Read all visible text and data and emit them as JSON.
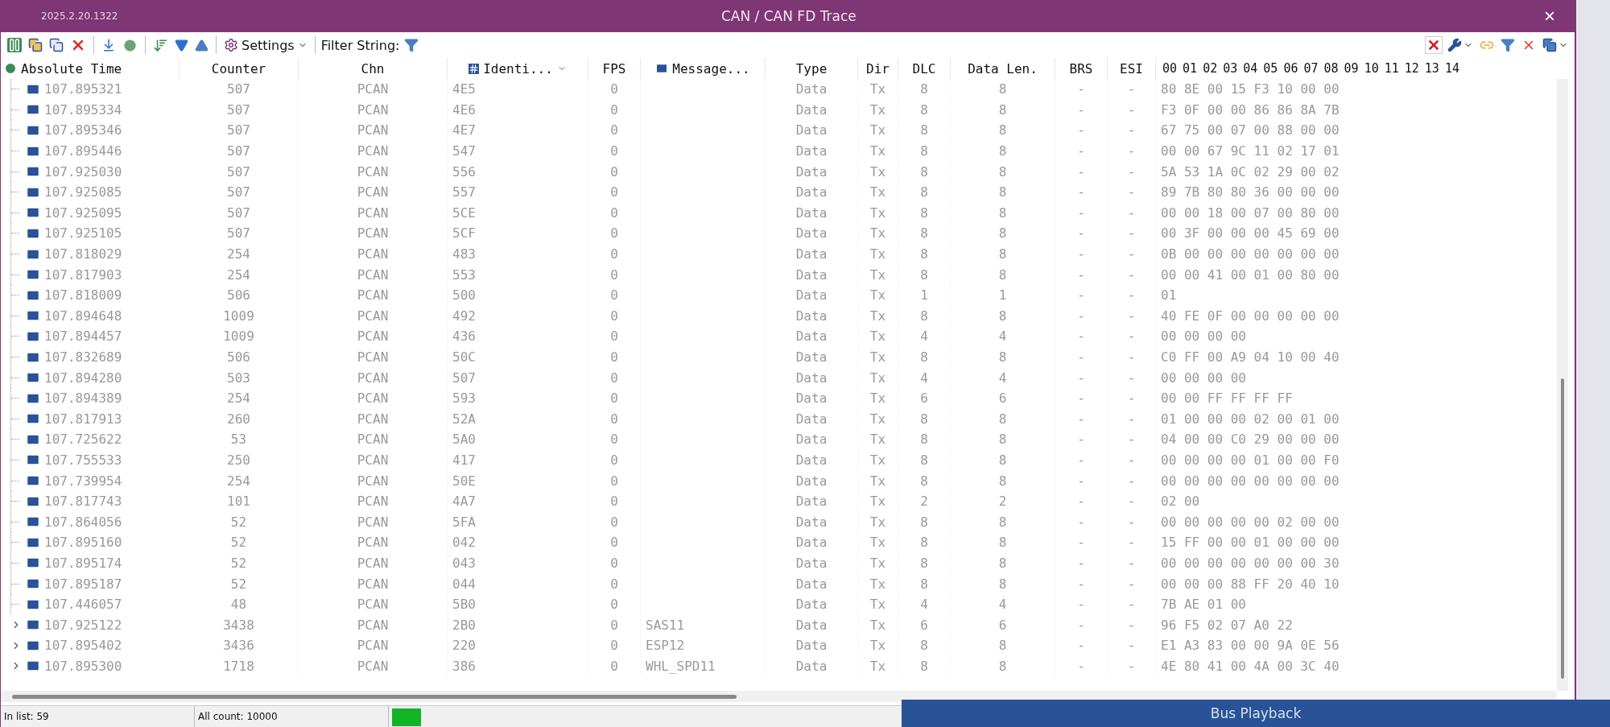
{
  "window": {
    "version": "2025.2.20.1322",
    "title": "CAN / CAN FD Trace",
    "close": "×"
  },
  "toolbar": {
    "settings": "Settings",
    "filter_label": "Filter String:"
  },
  "table": {
    "columns": [
      "Absolute Time",
      "Counter",
      "Chn",
      "Identi...",
      "FPS",
      "Message...",
      "Type",
      "Dir",
      "DLC",
      "Data Len.",
      "BRS",
      "ESI"
    ],
    "byte_columns": [
      "00",
      "01",
      "02",
      "03",
      "04",
      "05",
      "06",
      "07",
      "08",
      "09",
      "10",
      "11",
      "12",
      "13",
      "14"
    ],
    "rows": [
      {
        "kind": "leaf",
        "time": "107.895321",
        "counter": "507",
        "chn": "PCAN",
        "id": "4E5",
        "fps": "0",
        "type": "Data",
        "dir": "Tx",
        "dlc": "8",
        "len": "8",
        "brs": "-",
        "esi": "-",
        "data": "80 8E 00 15 F3 10 00 00"
      },
      {
        "kind": "leaf",
        "time": "107.895334",
        "counter": "507",
        "chn": "PCAN",
        "id": "4E6",
        "fps": "0",
        "type": "Data",
        "dir": "Tx",
        "dlc": "8",
        "len": "8",
        "brs": "-",
        "esi": "-",
        "data": "F3 0F 00 00 86 86 8A 7B"
      },
      {
        "kind": "leaf",
        "time": "107.895346",
        "counter": "507",
        "chn": "PCAN",
        "id": "4E7",
        "fps": "0",
        "type": "Data",
        "dir": "Tx",
        "dlc": "8",
        "len": "8",
        "brs": "-",
        "esi": "-",
        "data": "67 75 00 07 00 88 00 00"
      },
      {
        "kind": "leaf",
        "time": "107.895446",
        "counter": "507",
        "chn": "PCAN",
        "id": "547",
        "fps": "0",
        "type": "Data",
        "dir": "Tx",
        "dlc": "8",
        "len": "8",
        "brs": "-",
        "esi": "-",
        "data": "00 00 67 9C 11 02 17 01"
      },
      {
        "kind": "leaf",
        "time": "107.925030",
        "counter": "507",
        "chn": "PCAN",
        "id": "556",
        "fps": "0",
        "type": "Data",
        "dir": "Tx",
        "dlc": "8",
        "len": "8",
        "brs": "-",
        "esi": "-",
        "data": "5A 53 1A 0C 02 29 00 02"
      },
      {
        "kind": "leaf",
        "time": "107.925085",
        "counter": "507",
        "chn": "PCAN",
        "id": "557",
        "fps": "0",
        "type": "Data",
        "dir": "Tx",
        "dlc": "8",
        "len": "8",
        "brs": "-",
        "esi": "-",
        "data": "89 7B 80 80 36 00 00 00"
      },
      {
        "kind": "leaf",
        "time": "107.925095",
        "counter": "507",
        "chn": "PCAN",
        "id": "5CE",
        "fps": "0",
        "type": "Data",
        "dir": "Tx",
        "dlc": "8",
        "len": "8",
        "brs": "-",
        "esi": "-",
        "data": "00 00 18 00 07 00 80 00"
      },
      {
        "kind": "leaf",
        "time": "107.925105",
        "counter": "507",
        "chn": "PCAN",
        "id": "5CF",
        "fps": "0",
        "type": "Data",
        "dir": "Tx",
        "dlc": "8",
        "len": "8",
        "brs": "-",
        "esi": "-",
        "data": "00 3F 00 00 00 45 69 00"
      },
      {
        "kind": "leaf",
        "time": "107.818029",
        "counter": "254",
        "chn": "PCAN",
        "id": "483",
        "fps": "0",
        "type": "Data",
        "dir": "Tx",
        "dlc": "8",
        "len": "8",
        "brs": "-",
        "esi": "-",
        "data": "0B 00 00 00 00 00 00 00"
      },
      {
        "kind": "leaf",
        "time": "107.817903",
        "counter": "254",
        "chn": "PCAN",
        "id": "553",
        "fps": "0",
        "type": "Data",
        "dir": "Tx",
        "dlc": "8",
        "len": "8",
        "brs": "-",
        "esi": "-",
        "data": "00 00 41 00 01 00 80 00"
      },
      {
        "kind": "leaf",
        "time": "107.818009",
        "counter": "506",
        "chn": "PCAN",
        "id": "500",
        "fps": "0",
        "type": "Data",
        "dir": "Tx",
        "dlc": "1",
        "len": "1",
        "brs": "-",
        "esi": "-",
        "data": "01"
      },
      {
        "kind": "leaf",
        "time": "107.894648",
        "counter": "1009",
        "chn": "PCAN",
        "id": "492",
        "fps": "0",
        "type": "Data",
        "dir": "Tx",
        "dlc": "8",
        "len": "8",
        "brs": "-",
        "esi": "-",
        "data": "40 FE 0F 00 00 00 00 00"
      },
      {
        "kind": "leaf",
        "time": "107.894457",
        "counter": "1009",
        "chn": "PCAN",
        "id": "436",
        "fps": "0",
        "type": "Data",
        "dir": "Tx",
        "dlc": "4",
        "len": "4",
        "brs": "-",
        "esi": "-",
        "data": "00 00 00 00"
      },
      {
        "kind": "leaf",
        "time": "107.832689",
        "counter": "506",
        "chn": "PCAN",
        "id": "50C",
        "fps": "0",
        "type": "Data",
        "dir": "Tx",
        "dlc": "8",
        "len": "8",
        "brs": "-",
        "esi": "-",
        "data": "C0 FF 00 A9 04 10 00 40"
      },
      {
        "kind": "leaf",
        "time": "107.894280",
        "counter": "503",
        "chn": "PCAN",
        "id": "507",
        "fps": "0",
        "type": "Data",
        "dir": "Tx",
        "dlc": "4",
        "len": "4",
        "brs": "-",
        "esi": "-",
        "data": "00 00 00 00"
      },
      {
        "kind": "leaf",
        "time": "107.894389",
        "counter": "254",
        "chn": "PCAN",
        "id": "593",
        "fps": "0",
        "type": "Data",
        "dir": "Tx",
        "dlc": "6",
        "len": "6",
        "brs": "-",
        "esi": "-",
        "data": "00 00 FF FF FF FF"
      },
      {
        "kind": "leaf",
        "time": "107.817913",
        "counter": "260",
        "chn": "PCAN",
        "id": "52A",
        "fps": "0",
        "type": "Data",
        "dir": "Tx",
        "dlc": "8",
        "len": "8",
        "brs": "-",
        "esi": "-",
        "data": "01 00 00 00 02 00 01 00"
      },
      {
        "kind": "leaf",
        "time": "107.725622",
        "counter": "53",
        "chn": "PCAN",
        "id": "5A0",
        "fps": "0",
        "type": "Data",
        "dir": "Tx",
        "dlc": "8",
        "len": "8",
        "brs": "-",
        "esi": "-",
        "data": "04 00 00 C0 29 00 00 00"
      },
      {
        "kind": "leaf",
        "time": "107.755533",
        "counter": "250",
        "chn": "PCAN",
        "id": "417",
        "fps": "0",
        "type": "Data",
        "dir": "Tx",
        "dlc": "8",
        "len": "8",
        "brs": "-",
        "esi": "-",
        "data": "00 00 00 00 01 00 00 F0"
      },
      {
        "kind": "leaf",
        "time": "107.739954",
        "counter": "254",
        "chn": "PCAN",
        "id": "50E",
        "fps": "0",
        "type": "Data",
        "dir": "Tx",
        "dlc": "8",
        "len": "8",
        "brs": "-",
        "esi": "-",
        "data": "00 00 00 00 00 00 00 00"
      },
      {
        "kind": "leaf",
        "time": "107.817743",
        "counter": "101",
        "chn": "PCAN",
        "id": "4A7",
        "fps": "0",
        "type": "Data",
        "dir": "Tx",
        "dlc": "2",
        "len": "2",
        "brs": "-",
        "esi": "-",
        "data": "02 00"
      },
      {
        "kind": "leaf",
        "time": "107.864056",
        "counter": "52",
        "chn": "PCAN",
        "id": "5FA",
        "fps": "0",
        "type": "Data",
        "dir": "Tx",
        "dlc": "8",
        "len": "8",
        "brs": "-",
        "esi": "-",
        "data": "00 00 00 00 00 02 00 00"
      },
      {
        "kind": "leaf",
        "time": "107.895160",
        "counter": "52",
        "chn": "PCAN",
        "id": "042",
        "fps": "0",
        "type": "Data",
        "dir": "Tx",
        "dlc": "8",
        "len": "8",
        "brs": "-",
        "esi": "-",
        "data": "15 FF 00 00 01 00 00 00"
      },
      {
        "kind": "leaf",
        "time": "107.895174",
        "counter": "52",
        "chn": "PCAN",
        "id": "043",
        "fps": "0",
        "type": "Data",
        "dir": "Tx",
        "dlc": "8",
        "len": "8",
        "brs": "-",
        "esi": "-",
        "data": "00 00 00 00 00 00 00 30"
      },
      {
        "kind": "leaf",
        "time": "107.895187",
        "counter": "52",
        "chn": "PCAN",
        "id": "044",
        "fps": "0",
        "type": "Data",
        "dir": "Tx",
        "dlc": "8",
        "len": "8",
        "brs": "-",
        "esi": "-",
        "data": "00 00 00 88 FF 20 40 10"
      },
      {
        "kind": "leaf",
        "time": "107.446057",
        "counter": "48",
        "chn": "PCAN",
        "id": "5B0",
        "fps": "0",
        "type": "Data",
        "dir": "Tx",
        "dlc": "4",
        "len": "4",
        "brs": "-",
        "esi": "-",
        "data": "7B AE 01 00"
      },
      {
        "kind": "node",
        "time": "107.925122",
        "counter": "3438",
        "chn": "PCAN",
        "id": "2B0",
        "fps": "0",
        "message": "SAS11",
        "type": "Data",
        "dir": "Tx",
        "dlc": "6",
        "len": "6",
        "brs": "-",
        "esi": "-",
        "data": "96 F5 02 07 A0 22"
      },
      {
        "kind": "node",
        "time": "107.895402",
        "counter": "3436",
        "chn": "PCAN",
        "id": "220",
        "fps": "0",
        "message": "ESP12",
        "type": "Data",
        "dir": "Tx",
        "dlc": "8",
        "len": "8",
        "brs": "-",
        "esi": "-",
        "data": "E1 A3 83 00 00 9A 0E 56"
      },
      {
        "kind": "node",
        "time": "107.895300",
        "counter": "1718",
        "chn": "PCAN",
        "id": "386",
        "fps": "0",
        "message": "WHL_SPD11",
        "type": "Data",
        "dir": "Tx",
        "dlc": "8",
        "len": "8",
        "brs": "-",
        "esi": "-",
        "data": "4E 80 41 00 4A 00 3C 40"
      }
    ]
  },
  "status_bar": {
    "in_list": "In list: 59",
    "all_count": "All count: 10000"
  },
  "playback_bar": {
    "title": "Bus Playback"
  }
}
